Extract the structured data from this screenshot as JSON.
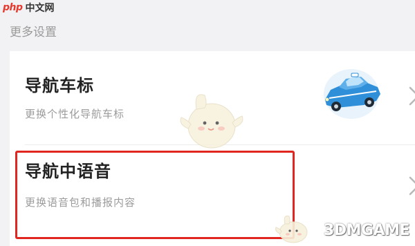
{
  "watermark_top": {
    "logo_text": "php",
    "site_text": "中文网"
  },
  "section": {
    "header": "更多设置"
  },
  "items": [
    {
      "title": "导航车标",
      "subtitle": "更换个性化导航车标",
      "icon": "car-icon"
    },
    {
      "title": "导航中语音",
      "subtitle": "更换语音包和播报内容",
      "icon": "chevron-right-icon"
    }
  ],
  "colors": {
    "highlight_border": "#e0261e",
    "car_body": "#2f8fd8",
    "background": "#f2f2f4"
  },
  "watermark_bottom": {
    "text": "3DMGAME"
  }
}
